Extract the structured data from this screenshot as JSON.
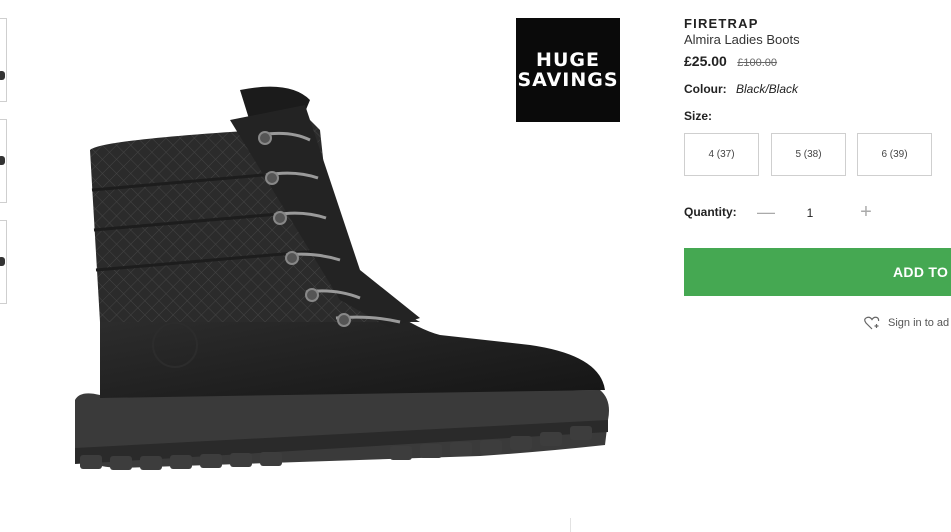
{
  "promo": {
    "line1": "HUGE",
    "line2": "SAVINGS"
  },
  "product": {
    "brand": "FIRETRAP",
    "name": "Almira Ladies Boots",
    "price_now": "£25.00",
    "price_was": "£100.00",
    "colour_label": "Colour:",
    "colour_value": "Black/Black"
  },
  "size": {
    "label": "Size:",
    "options": [
      "4 (37)",
      "5 (38)",
      "6 (39)"
    ]
  },
  "quantity": {
    "label": "Quantity:",
    "value": "1",
    "minus": "—",
    "plus": "+"
  },
  "actions": {
    "add_to_bag": "ADD TO",
    "wishlist": "Sign in to ad"
  },
  "colors": {
    "accent_green": "#45a852",
    "badge_bg": "#0a0a0a"
  },
  "icons": {
    "wishlist": "heart-plus-icon"
  }
}
